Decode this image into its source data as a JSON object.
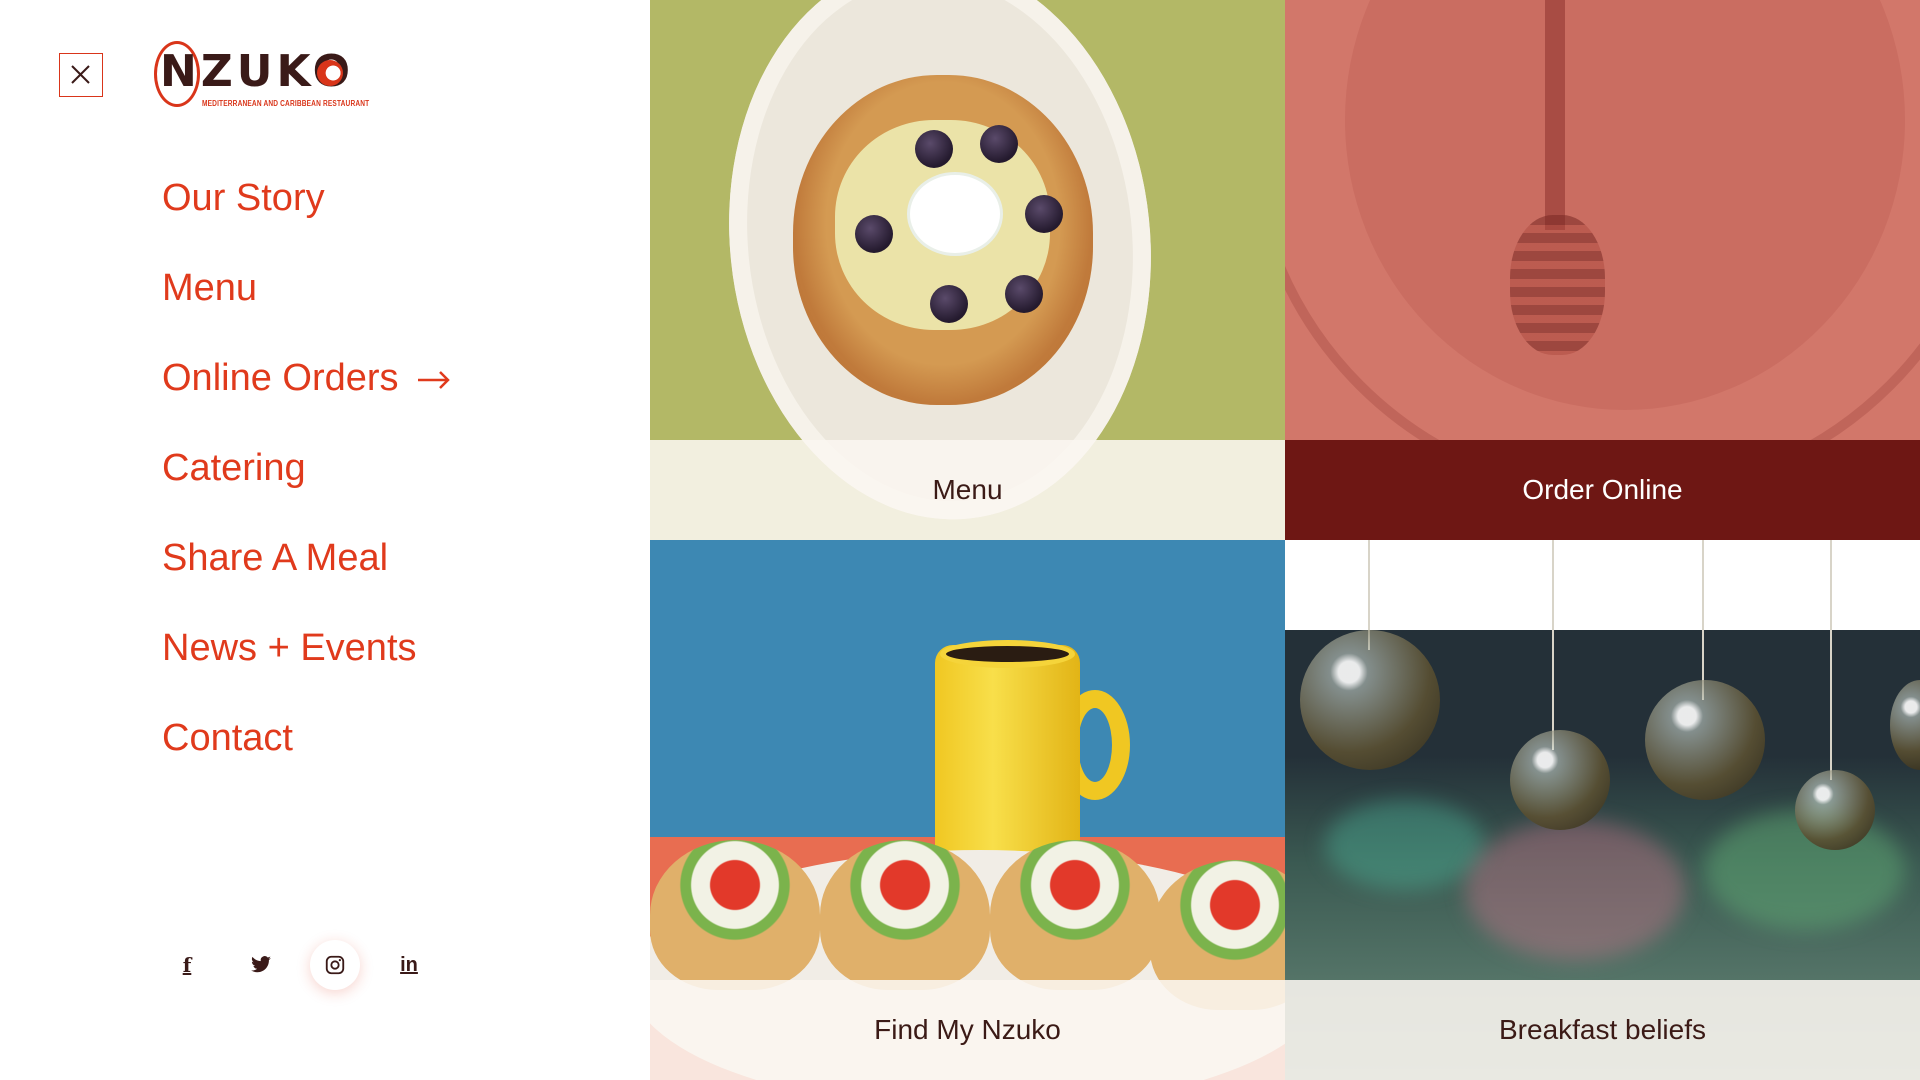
{
  "brand": {
    "name": "NZUKO",
    "tagline": "MEDITERRANEAN AND CARIBBEAN RESTAURANT"
  },
  "nav": {
    "items": [
      {
        "label": "Our Story"
      },
      {
        "label": "Menu"
      },
      {
        "label": "Online Orders"
      },
      {
        "label": "Catering"
      },
      {
        "label": "Share A Meal"
      },
      {
        "label": "News + Events"
      },
      {
        "label": "Contact"
      }
    ]
  },
  "social": [
    {
      "icon": "facebook-icon",
      "glyph": "f"
    },
    {
      "icon": "twitter-icon",
      "glyph": ""
    },
    {
      "icon": "instagram-icon",
      "glyph": "",
      "active": true
    },
    {
      "icon": "linkedin-icon",
      "glyph": "in"
    }
  ],
  "tiles": {
    "menu": {
      "label": "Menu"
    },
    "order": {
      "label": "Order Online"
    },
    "find": {
      "label": "Find  My Nzuko"
    },
    "breakfast": {
      "label": "Breakfast beliefs"
    }
  },
  "colors": {
    "accent": "#e03a1c",
    "dark_text": "#3a1a18",
    "order_band": "#6e1714"
  }
}
